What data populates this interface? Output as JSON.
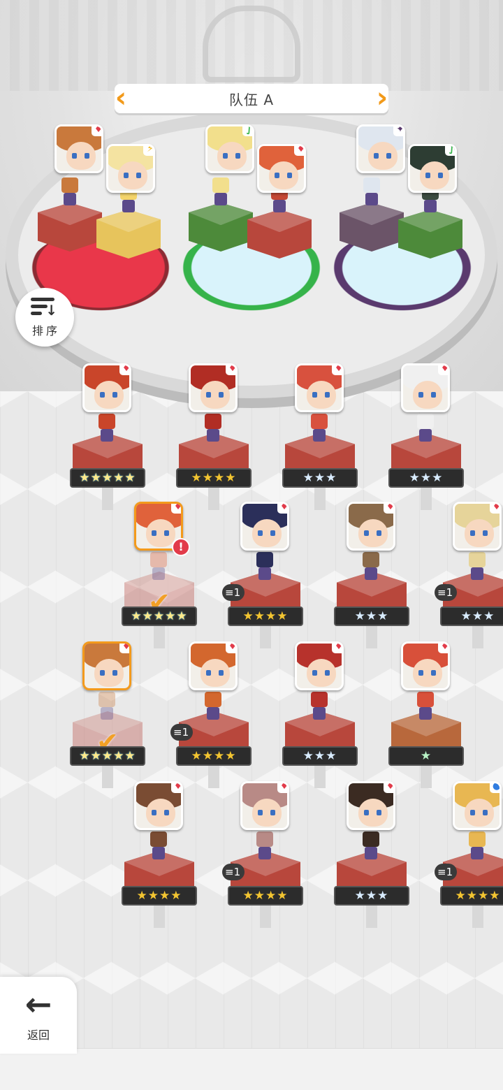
{
  "team": {
    "title": "队伍 A",
    "prev_icon": "chevron-left-icon",
    "next_icon": "chevron-right-icon"
  },
  "formation": [
    {
      "slot": 1,
      "element": "fire",
      "color": "#e23b4a",
      "heroes": [
        {
          "portrait_hair": "#c9793c",
          "element": "fire",
          "pedestal": "#b8473c",
          "sprite": "#c9793c"
        },
        {
          "portrait_hair": "#f4e3a1",
          "element": "light",
          "pedestal": "#e7c45c",
          "sprite": "#f4d46a"
        }
      ]
    },
    {
      "slot": 2,
      "element": "wind",
      "color": "#36b34a",
      "heroes": [
        {
          "portrait_hair": "#f2df8c",
          "element": "wind",
          "pedestal": "#4d8a3a",
          "sprite": "#f2df8c"
        },
        {
          "portrait_hair": "#e0623b",
          "element": "fire",
          "pedestal": "#b8473c",
          "sprite": "#c44734"
        }
      ]
    },
    {
      "slot": 3,
      "element": "dark",
      "color": "#5a3a6e",
      "heroes": [
        {
          "portrait_hair": "#dfe6ef",
          "element": "dark",
          "pedestal": "#6b5468",
          "sprite": "#dfe6ef"
        },
        {
          "portrait_hair": "#2d3d33",
          "element": "wind",
          "pedestal": "#4d8a3a",
          "sprite": "#3b4b40"
        }
      ]
    }
  ],
  "sort_button": {
    "label": "排序",
    "icon": "sort-icon"
  },
  "roster": [
    {
      "hair": "#c9452a",
      "element": "fire",
      "stars": "★★★★★",
      "rarity": 5,
      "selected": false,
      "dup": ""
    },
    {
      "hair": "#b12d24",
      "element": "fire",
      "stars": "★★★★",
      "rarity": 4,
      "selected": false,
      "dup": ""
    },
    {
      "hair": "#d8513e",
      "element": "fire",
      "stars": "★★★",
      "rarity": 3,
      "selected": false,
      "dup": ""
    },
    {
      "hair": "#f0f0f0",
      "element": "fire",
      "stars": "★★★",
      "rarity": 3,
      "selected": false,
      "dup": ""
    },
    {
      "hair": "#e0623b",
      "element": "fire",
      "stars": "★★★★★",
      "rarity": 5,
      "selected": true,
      "dup": "",
      "alert": "!"
    },
    {
      "hair": "#2b2f5a",
      "element": "fire",
      "stars": "★★★★",
      "rarity": 4,
      "selected": false,
      "dup": "1"
    },
    {
      "hair": "#8a6a4a",
      "element": "fire",
      "stars": "★★★",
      "rarity": 3,
      "selected": false,
      "dup": ""
    },
    {
      "hair": "#e6d49a",
      "element": "fire",
      "stars": "★★★",
      "rarity": 3,
      "selected": false,
      "dup": "1"
    },
    {
      "hair": "#c9793c",
      "element": "fire",
      "stars": "★★★★★",
      "rarity": 5,
      "selected": true,
      "dup": ""
    },
    {
      "hair": "#d3672e",
      "element": "fire",
      "stars": "★★★★",
      "rarity": 4,
      "selected": false,
      "dup": "1"
    },
    {
      "hair": "#b7322c",
      "element": "fire",
      "stars": "★★★",
      "rarity": 3,
      "selected": false,
      "dup": ""
    },
    {
      "hair": "#d8503a",
      "element": "fire",
      "stars": "★",
      "rarity": 1,
      "selected": false,
      "dup": ""
    },
    {
      "hair": "#7a4c33",
      "element": "fire",
      "stars": "★★★★",
      "rarity": 4,
      "selected": false,
      "dup": ""
    },
    {
      "hair": "#b88a86",
      "element": "fire",
      "stars": "★★★★",
      "rarity": 4,
      "selected": false,
      "dup": "1"
    },
    {
      "hair": "#3b2b22",
      "element": "fire",
      "stars": "★★★",
      "rarity": 3,
      "selected": false,
      "dup": ""
    },
    {
      "hair": "#e8b752",
      "element": "water",
      "stars": "★★★★",
      "rarity": 4,
      "selected": false,
      "dup": "1"
    }
  ],
  "back_button": {
    "label": "返回",
    "icon": "back-arrow-icon"
  }
}
